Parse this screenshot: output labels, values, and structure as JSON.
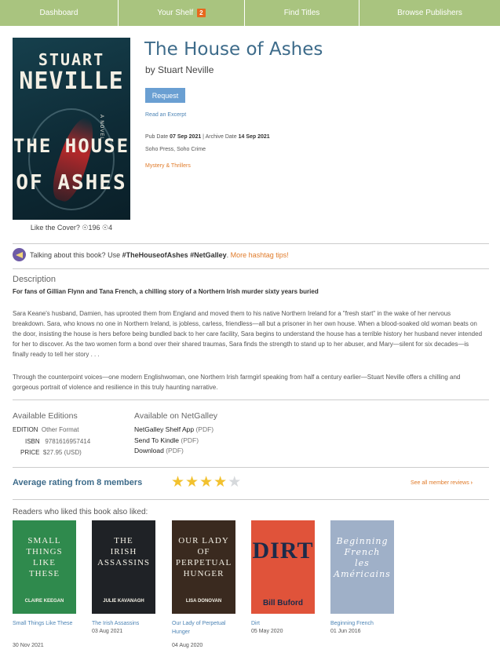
{
  "nav": {
    "items": [
      {
        "label": "Dashboard"
      },
      {
        "label": "Your Shelf",
        "badge": "2"
      },
      {
        "label": "Find Titles"
      },
      {
        "label": "Browse Publishers"
      }
    ]
  },
  "book": {
    "cover": {
      "author_line1": "STUART",
      "author_line2": "NEVILLE",
      "novel": "A NOVEL",
      "title_line1": "THE HOUSE",
      "title_line2": "OF ASHES"
    },
    "like_label": "Like the Cover?",
    "likes_up": "196",
    "likes_down": "4",
    "title": "The House of Ashes",
    "author": "by Stuart Neville",
    "request_label": "Request",
    "excerpt_label": "Read an Excerpt",
    "pub_date_label": "Pub Date",
    "pub_date": "07 Sep 2021",
    "archive_date_label": "Archive Date",
    "archive_date": "14 Sep 2021",
    "publisher": "Soho Press, Soho Crime",
    "category": "Mystery & Thrillers"
  },
  "talking": {
    "prefix": "Talking about this book? Use",
    "hashtags": "#TheHouseofAshes #NetGalley",
    "tips": "More hashtag tips!"
  },
  "description": {
    "heading": "Description",
    "tagline": "For fans of Gillian Flynn and Tana French, a chilling story of a Northern Irish murder sixty years buried",
    "para1": "Sara Keane's husband, Damien, has uprooted them from England and moved them to his native Northern Ireland for a \"fresh start\" in the wake of her nervous breakdown. Sara, who knows no one in Northern Ireland, is jobless, carless, friendless—all but a prisoner in her own house. When a blood-soaked old woman beats on the door, insisting the house is hers before being bundled back to her care facility, Sara begins to understand the house has a terrible history her husband never intended for her to discover. As the two women form a bond over their shared traumas, Sara finds the strength to stand up to her abuser, and Mary—silent for six decades—is finally ready to tell her story . . .",
    "para2": "Through the counterpoint voices—one modern Englishwoman, one Northern Irish farmgirl speaking from half a century earlier—Stuart Neville offers a chilling and gorgeous portrait of violence and resilience in this truly haunting narrative."
  },
  "editions": {
    "heading": "Available Editions",
    "rows": [
      {
        "label": "EDITION",
        "value": "Other Format"
      },
      {
        "label": "ISBN",
        "value": "9781616957414"
      },
      {
        "label": "PRICE",
        "value": "$27.95 (USD)"
      }
    ]
  },
  "netgalley": {
    "heading": "Available on NetGalley",
    "items": [
      {
        "label": "NetGalley Shelf App",
        "format": "(PDF)"
      },
      {
        "label": "Send To Kindle",
        "format": "(PDF)"
      },
      {
        "label": "Download",
        "format": "(PDF)"
      }
    ]
  },
  "rating": {
    "label": "Average rating from 8 members",
    "value": 4,
    "max": 5,
    "see_all": "See all member reviews"
  },
  "recommended": {
    "heading": "Readers who liked this book also liked:",
    "books": [
      {
        "title": "Small Things Like These",
        "date": "30 Nov 2021",
        "cover_lines": [
          "SMALL",
          "THINGS",
          "LIKE",
          "THESE"
        ],
        "cover_author": "CLAIRE KEEGAN",
        "color": "#2f8a4d"
      },
      {
        "title": "The Irish Assassins",
        "date": "03 Aug 2021",
        "cover_lines": [
          "THE",
          "IRISH",
          "ASSASSINS"
        ],
        "cover_author": "JULIE KAVANAGH",
        "color": "#1f2226"
      },
      {
        "title": "Our Lady of Perpetual Hunger",
        "date": "04 Aug 2020",
        "cover_lines": [
          "OUR LADY",
          "OF",
          "PERPETUAL",
          "HUNGER"
        ],
        "cover_author": "LISA DONOVAN",
        "color": "#3a2a1f"
      },
      {
        "title": "Dirt",
        "date": "05 May 2020",
        "cover_lines": [
          "DIRT"
        ],
        "cover_author": "Bill Buford",
        "color": "#e0533a"
      },
      {
        "title": "Beginning French",
        "date": "01 Jun 2016",
        "cover_lines": [
          "Beginning",
          "French",
          "les",
          "Américains"
        ],
        "cover_author": "",
        "color": "#9fb0c8"
      }
    ]
  },
  "colors": {
    "nav": "#a9c47f",
    "badge": "#e8681d",
    "title": "#3d6b8a",
    "link": "#4d84b5",
    "accent": "#e07b2a",
    "star": "#f2c12e"
  }
}
